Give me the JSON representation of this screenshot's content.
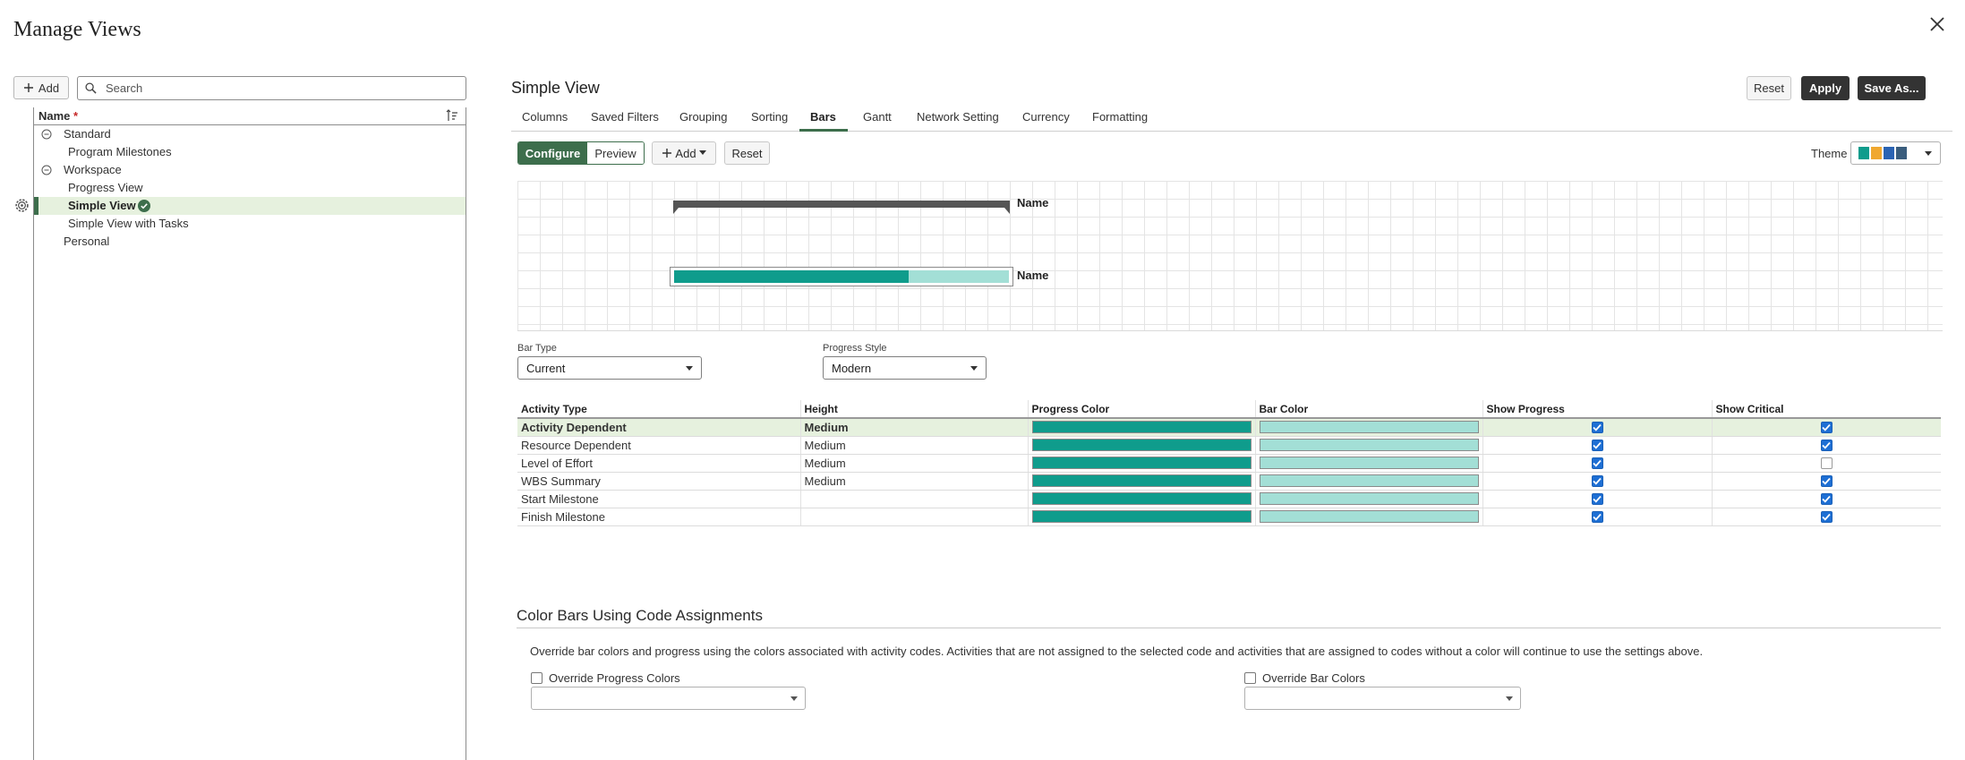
{
  "dialog": {
    "title": "Manage Views",
    "close_label": "Close"
  },
  "left": {
    "add_label": "Add",
    "search_placeholder": "Search",
    "tree_header": "Name",
    "required_mark": "*",
    "items": [
      {
        "label": "Standard",
        "toggle": true
      },
      {
        "label": "Program Milestones",
        "toggle": false
      },
      {
        "label": "Workspace",
        "toggle": true
      },
      {
        "label": "Progress View",
        "toggle": false
      },
      {
        "label": "Simple View",
        "toggle": false,
        "selected": true
      },
      {
        "label": "Simple View with Tasks",
        "toggle": false
      },
      {
        "label": "Personal",
        "toggle": false
      }
    ]
  },
  "right": {
    "title": "Simple View",
    "reset_label": "Reset",
    "apply_label": "Apply",
    "save_as_label": "Save As...",
    "tabs": [
      "Columns",
      "Saved Filters",
      "Grouping",
      "Sorting",
      "Bars",
      "Gantt",
      "Network Setting",
      "Currency",
      "Formatting"
    ],
    "active_tab": "Bars",
    "configure_label": "Configure",
    "preview_label": "Preview",
    "add_label": "Add",
    "reset2_label": "Reset",
    "theme_label": "Theme",
    "theme_colors": [
      "#0f9c8c",
      "#f0a830",
      "#2a63b3",
      "#3a5d7d"
    ],
    "preview_bar_label_1": "Name",
    "preview_bar_label_2": "Name",
    "preview_progress": 0.7,
    "bar_type_label": "Bar Type",
    "bar_type_value": "Current",
    "progress_style_label": "Progress Style",
    "progress_style_value": "Modern"
  },
  "grid": {
    "headers": [
      "Activity Type",
      "Height",
      "Progress Color",
      "Bar Color",
      "Show Progress",
      "Show Critical"
    ],
    "progress_color": "#0f9c8c",
    "bar_color": "#a3dfd6",
    "rows": [
      {
        "type": "Activity Dependent",
        "height": "Medium",
        "show_progress": true,
        "show_critical": true
      },
      {
        "type": "Resource Dependent",
        "height": "Medium",
        "show_progress": true,
        "show_critical": true
      },
      {
        "type": "Level of Effort",
        "height": "Medium",
        "show_progress": true,
        "show_critical": false
      },
      {
        "type": "WBS Summary",
        "height": "Medium",
        "show_progress": true,
        "show_critical": true
      },
      {
        "type": "Start Milestone",
        "height": "",
        "show_progress": true,
        "show_critical": true
      },
      {
        "type": "Finish Milestone",
        "height": "",
        "show_progress": true,
        "show_critical": true
      }
    ]
  },
  "code_assign": {
    "title": "Color Bars Using Code Assignments",
    "description": "Override bar colors and progress using the colors associated with activity codes. Activities that are not assigned to the selected code and activities that are assigned to codes without a color will continue to use the settings above.",
    "override_progress_label": "Override Progress Colors",
    "override_bar_label": "Override Bar Colors"
  }
}
